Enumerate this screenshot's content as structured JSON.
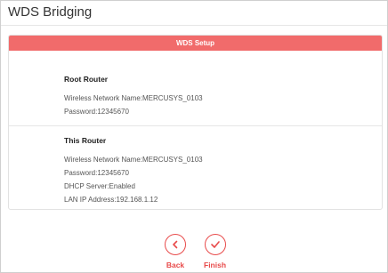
{
  "page": {
    "title": "WDS Bridging"
  },
  "panel": {
    "header": "WDS Setup",
    "root_router": {
      "heading": "Root Router",
      "lines": [
        "Wireless Network Name:MERCUSYS_0103",
        "Password:12345670"
      ]
    },
    "this_router": {
      "heading": "This Router",
      "lines": [
        "Wireless Network Name:MERCUSYS_0103",
        "Password:12345670",
        "DHCP Server:Enabled",
        "LAN IP Address:192.168.1.12"
      ]
    }
  },
  "buttons": {
    "back_label": "Back",
    "finish_label": "Finish"
  },
  "colors": {
    "accent": "#e84a4a",
    "header_bg": "#f16b6b"
  }
}
